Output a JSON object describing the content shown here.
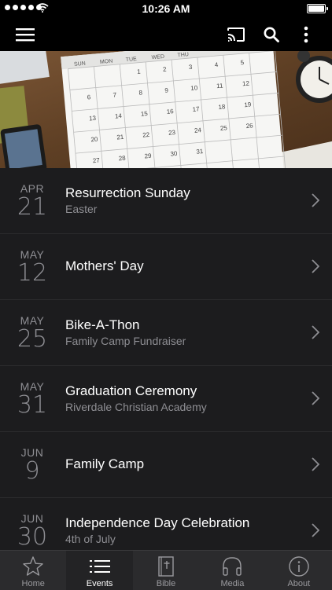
{
  "status_bar": {
    "time": "10:26 AM"
  },
  "toolbar": {
    "menu_icon": "hamburger-menu-icon",
    "cast_icon": "cast-icon",
    "search_icon": "search-icon",
    "more_icon": "more-vertical-icon"
  },
  "banner": {
    "calendar_weekdays": [
      "SUN",
      "MON",
      "TUE",
      "WED",
      "THU"
    ],
    "calendar_days": [
      "1",
      "2",
      "3",
      "4",
      "5",
      "6",
      "7",
      "8",
      "9",
      "10",
      "11",
      "12",
      "13",
      "14",
      "15",
      "16",
      "17",
      "18",
      "19",
      "20",
      "21",
      "22",
      "23",
      "24",
      "25",
      "26",
      "27",
      "28",
      "29",
      "30",
      "31"
    ]
  },
  "events": [
    {
      "month": "APR",
      "day": "21",
      "title": "Resurrection Sunday",
      "subtitle": "Easter"
    },
    {
      "month": "MAY",
      "day": "12",
      "title": "Mothers' Day",
      "subtitle": ""
    },
    {
      "month": "MAY",
      "day": "25",
      "title": "Bike-A-Thon",
      "subtitle": "Family Camp Fundraiser"
    },
    {
      "month": "MAY",
      "day": "31",
      "title": "Graduation Ceremony",
      "subtitle": "Riverdale Christian Academy"
    },
    {
      "month": "JUN",
      "day": "9",
      "title": "Family Camp",
      "subtitle": ""
    },
    {
      "month": "JUN",
      "day": "30",
      "title": "Independence Day Celebration",
      "subtitle": "4th of July"
    }
  ],
  "tabbar": {
    "active": "Events",
    "tabs": [
      {
        "label": "Home",
        "icon": "star-icon"
      },
      {
        "label": "Events",
        "icon": "list-icon"
      },
      {
        "label": "Bible",
        "icon": "bible-icon"
      },
      {
        "label": "Media",
        "icon": "headphones-icon"
      },
      {
        "label": "About",
        "icon": "info-icon"
      }
    ]
  },
  "colors": {
    "background": "#1c1c1e",
    "bar": "#000000",
    "tabbar": "#2b2b2d",
    "muted_text": "#8e8e93"
  }
}
